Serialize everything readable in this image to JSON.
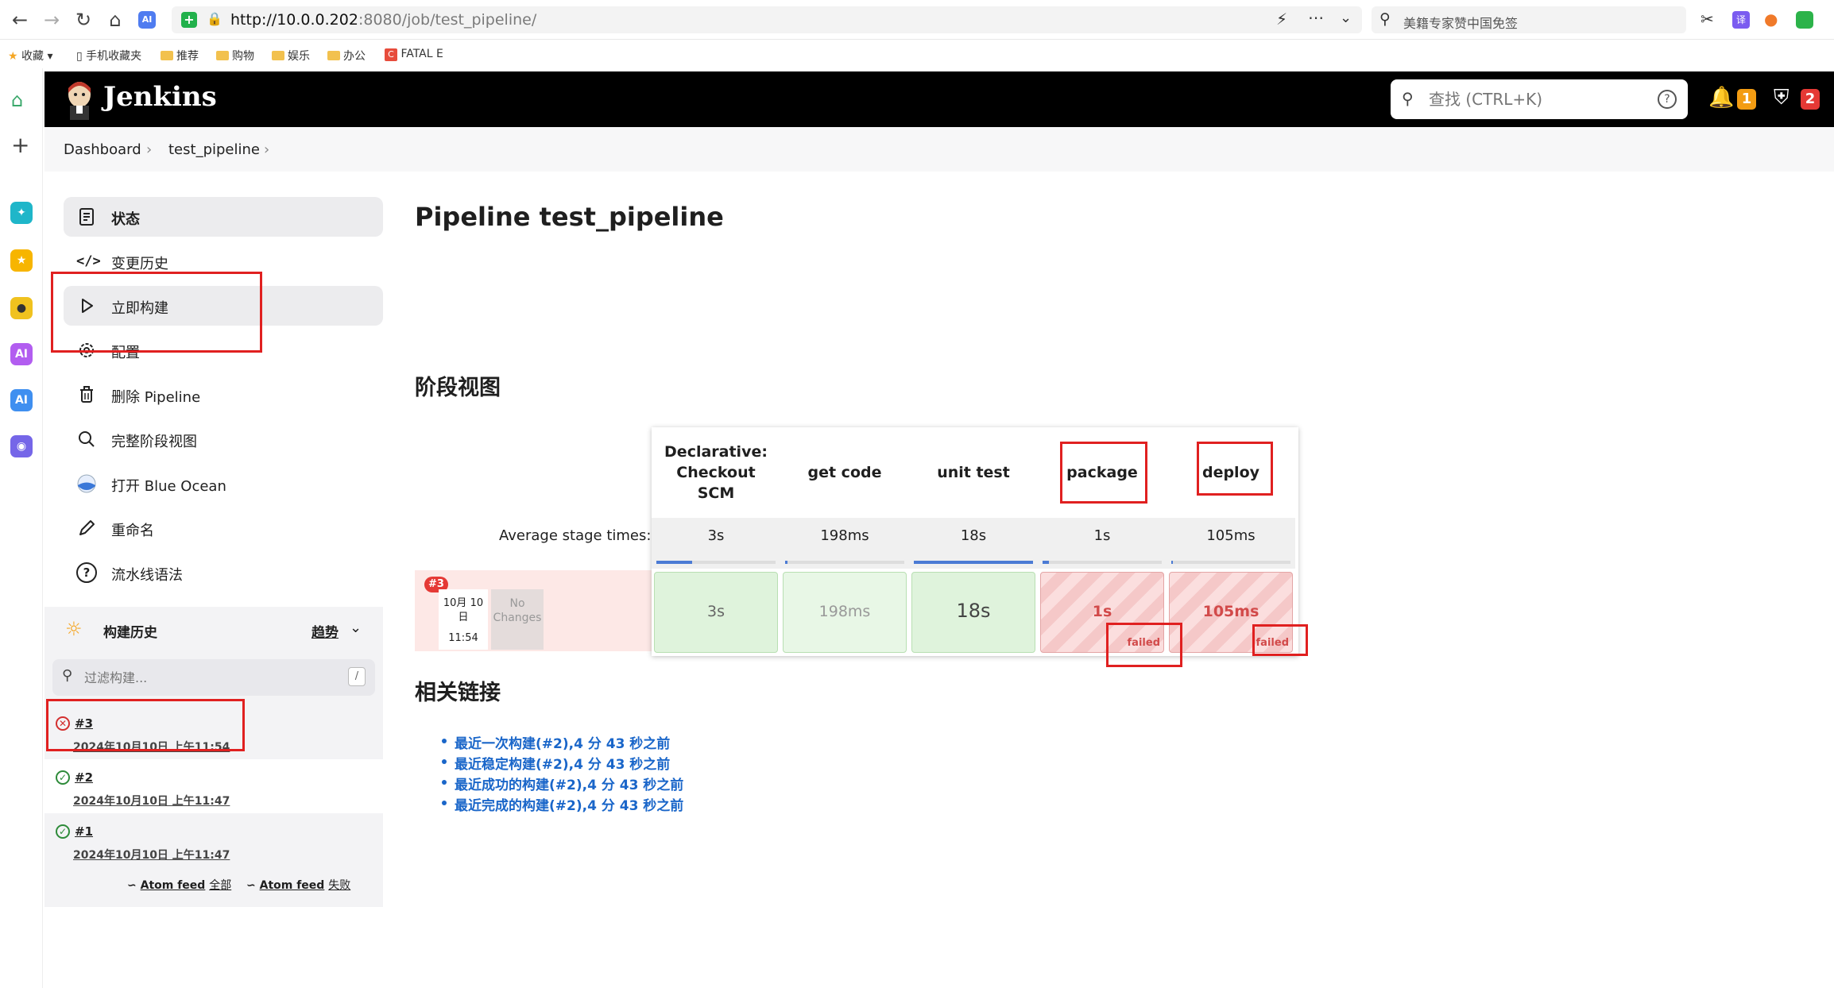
{
  "browser": {
    "url_host": "http://10.0.0.202",
    "url_path": ":8080/job/test_pipeline/",
    "search_placeholder": "美籍专家赞中国免签",
    "bookmarks": [
      "收藏",
      "手机收藏夹",
      "推荐",
      "购物",
      "娱乐",
      "办公",
      "FATAL E"
    ]
  },
  "header": {
    "title": "Jenkins",
    "search_placeholder": "查找 (CTRL+K)",
    "notifications_count": "1",
    "security_count": "2"
  },
  "breadcrumb": [
    "Dashboard",
    "test_pipeline"
  ],
  "sidebar": {
    "items": [
      {
        "label": "状态"
      },
      {
        "label": "变更历史"
      },
      {
        "label": "立即构建"
      },
      {
        "label": "配置"
      },
      {
        "label": "删除 Pipeline"
      },
      {
        "label": "完整阶段视图"
      },
      {
        "label": "打开 Blue Ocean"
      },
      {
        "label": "重命名"
      },
      {
        "label": "流水线语法"
      }
    ]
  },
  "build_history": {
    "title": "构建历史",
    "trend": "趋势",
    "filter_placeholder": "过滤构建...",
    "filter_shortcut": "/",
    "builds": [
      {
        "number": "#3",
        "date": "2024年10月10日 上午11:54",
        "status": "failed"
      },
      {
        "number": "#2",
        "date": "2024年10月10日 上午11:47",
        "status": "success"
      },
      {
        "number": "#1",
        "date": "2024年10月10日 上午11:47",
        "status": "success"
      }
    ],
    "feed_all_a": "Atom feed",
    "feed_all_b": "全部",
    "feed_fail_a": "Atom feed",
    "feed_fail_b": "失败"
  },
  "main": {
    "title": "Pipeline test_pipeline",
    "stage_view_title": "阶段视图",
    "avg_label": "Average stage times:",
    "stages": [
      {
        "name_l1": "Declarative:",
        "name_l2": "Checkout",
        "name_l3": "SCM",
        "avg": "3s",
        "avg_fraction": 0.3,
        "run": "3s",
        "status": "success"
      },
      {
        "name_l1": "get code",
        "avg": "198ms",
        "avg_fraction": 0.02,
        "run": "198ms",
        "status": "success"
      },
      {
        "name_l1": "unit test",
        "avg": "18s",
        "avg_fraction": 1.0,
        "run": "18s",
        "status": "success"
      },
      {
        "name_l1": "package",
        "avg": "1s",
        "avg_fraction": 0.05,
        "run": "1s",
        "status": "failed"
      },
      {
        "name_l1": "deploy",
        "avg": "105ms",
        "avg_fraction": 0.01,
        "run": "105ms",
        "status": "failed"
      }
    ],
    "run": {
      "badge": "#3",
      "date_l1": "10月 10",
      "date_l2": "日",
      "time": "11:54",
      "changes_l1": "No",
      "changes_l2": "Changes"
    },
    "failed_label": "failed",
    "related_title": "相关链接",
    "related_links": [
      "最近一次构建(#2),4 分 43 秒之前",
      "最近稳定构建(#2),4 分 43 秒之前",
      "最近成功的构建(#2),4 分 43 秒之前",
      "最近完成的构建(#2),4 分 43 秒之前"
    ]
  },
  "colors": {
    "header_bg": "#000000",
    "success_cell": "#dff3dc",
    "failed_cell": "#fbdede",
    "link": "#1a66c9",
    "annotation": "#e02020"
  }
}
